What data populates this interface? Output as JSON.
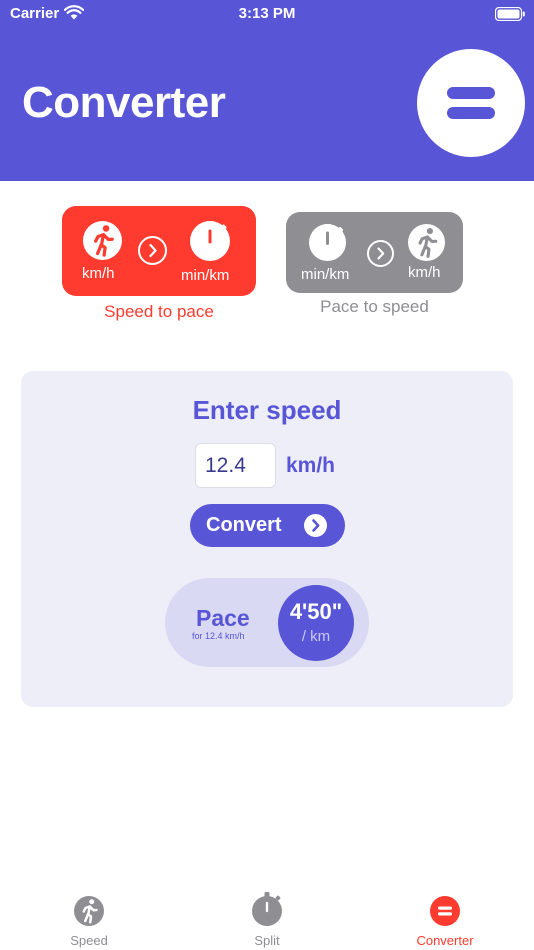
{
  "status_bar": {
    "carrier": "Carrier",
    "time": "3:13 PM"
  },
  "header": {
    "title": "Converter"
  },
  "modes": [
    {
      "from_unit": "km/h",
      "to_unit": "min/km",
      "caption": "Speed to pace",
      "selected": true,
      "color": "#FF3B30"
    },
    {
      "from_unit": "min/km",
      "to_unit": "km/h",
      "caption": "Pace to speed",
      "selected": false,
      "color": "#8E8E93"
    }
  ],
  "card": {
    "title": "Enter speed",
    "input_value": "12.4",
    "unit": "km/h",
    "convert_label": "Convert"
  },
  "result": {
    "label": "Pace",
    "sub": "for 12.4 km/h",
    "value": "4'50\"",
    "unit": "/ km"
  },
  "tabs": [
    {
      "label": "Speed",
      "icon": "runner-icon",
      "active": false
    },
    {
      "label": "Split",
      "icon": "stopwatch-icon",
      "active": false
    },
    {
      "label": "Converter",
      "icon": "equals-icon",
      "active": true
    }
  ],
  "colors": {
    "accent": "#5856D6",
    "active": "#FF3B30",
    "inactive": "#8E8E93",
    "card": "#EEEEF8"
  }
}
